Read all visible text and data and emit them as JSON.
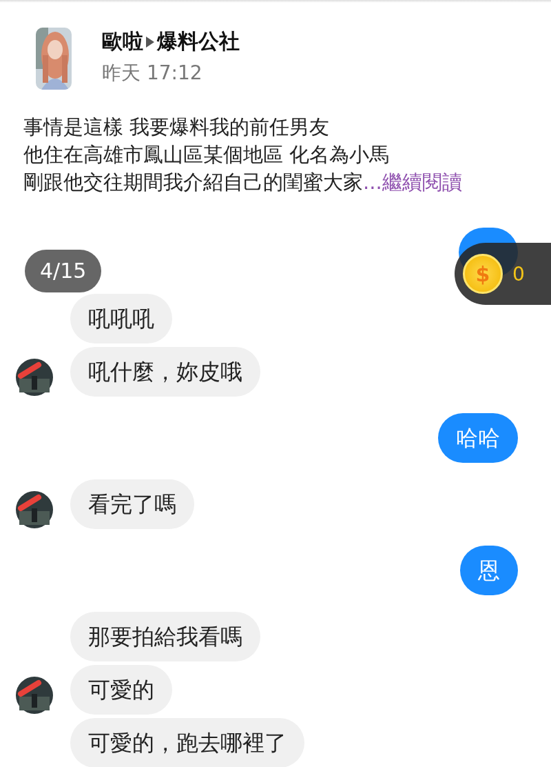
{
  "post": {
    "author": "歐啦",
    "group": "爆料公社",
    "time": "昨天 17:12",
    "lines": [
      "事情是這樣 我要爆料我的前任男友",
      "他住在高雄市鳳山區某個地區 化名為小馬",
      "剛跟他交往期間我介紹自己的閨蜜大家"
    ],
    "more_link": "...繼續閱讀"
  },
  "chat": {
    "page_badge": "4/15",
    "coins": {
      "symbol": "$",
      "count": "0"
    },
    "messages": [
      {
        "kind": "covered"
      },
      {
        "kind": "received",
        "text": "吼吼吼",
        "avatar": false
      },
      {
        "kind": "received",
        "text": "吼什麼，妳皮哦",
        "avatar": true
      },
      {
        "kind": "sent",
        "text": "哈哈"
      },
      {
        "kind": "received",
        "text": "看完了嗎",
        "avatar": true
      },
      {
        "kind": "sent",
        "text": "恩"
      },
      {
        "kind": "received",
        "text": "那要拍給我看嗎",
        "avatar": false
      },
      {
        "kind": "received",
        "text": "可愛的",
        "avatar": true
      },
      {
        "kind": "received",
        "text": "可愛的，跑去哪裡了",
        "avatar": false
      }
    ]
  }
}
